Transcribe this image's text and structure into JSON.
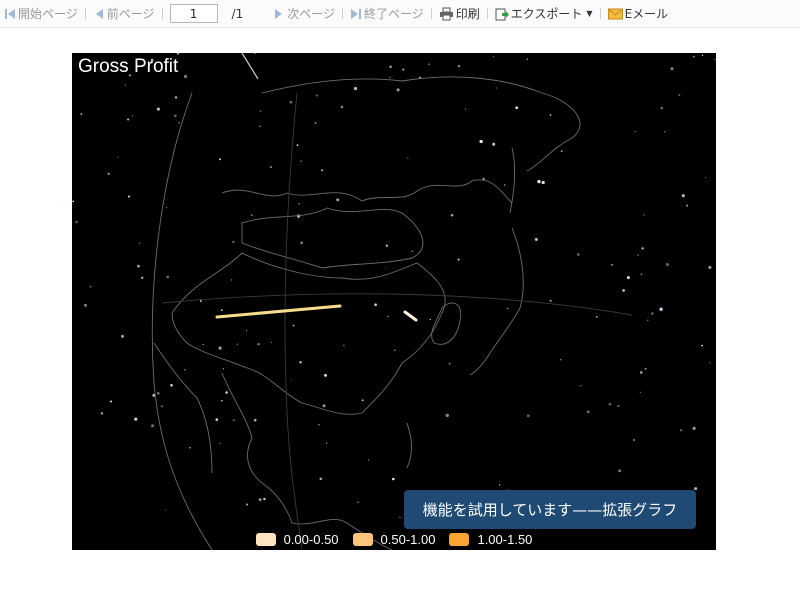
{
  "toolbar": {
    "first_page": "開始ページ",
    "prev_page": "前ページ",
    "page_value": "1",
    "page_total": "/1",
    "next_page": "次ページ",
    "last_page": "終了ページ",
    "print": "印刷",
    "export": "エクスポート",
    "email": "Eメール"
  },
  "chart": {
    "title": "Gross Profit",
    "trial_notice": "機能を試用しています——拡張グラフ",
    "legend": [
      {
        "label": "0.00-0.50",
        "color": "#fde3bf"
      },
      {
        "label": "0.50-1.00",
        "color": "#fdc57a"
      },
      {
        "label": "1.00-1.50",
        "color": "#f9a531"
      }
    ],
    "flow_color": "#f5dc8c"
  }
}
